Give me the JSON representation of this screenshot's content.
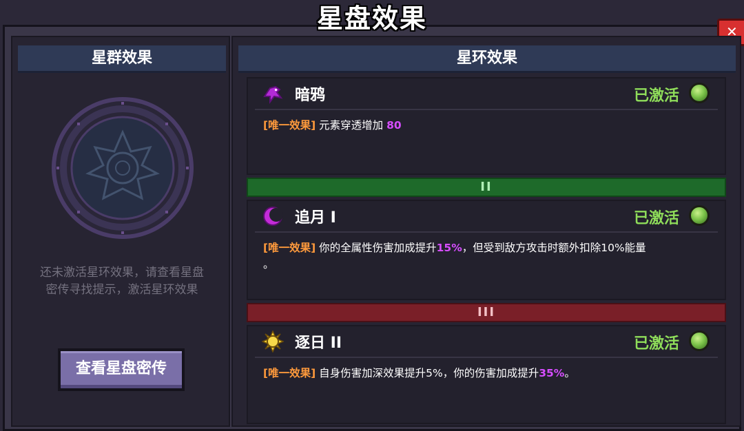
{
  "window": {
    "title": "星盘效果"
  },
  "left": {
    "title": "星群效果",
    "hint_line1": "还未激活星环效果，请查看星盘",
    "hint_line2": "密传寻找提示，激活星环效果",
    "button": "查看星盘密传"
  },
  "right": {
    "title": "星环效果",
    "effects": [
      {
        "name": "暗鸦",
        "icon": "raven-icon",
        "status": "已激活",
        "tag": "[唯一效果]",
        "desc_pre": "元素穿透增加",
        "highlight": "80",
        "desc_post": "",
        "desc_line2": ""
      },
      {
        "name": "追月 I",
        "icon": "crescent-moon-icon",
        "status": "已激活",
        "tag": "[唯一效果]",
        "desc_pre": "你的全属性伤害加成提升",
        "highlight": "15%",
        "desc_post": "，但受到敌方攻击时额外扣除10%能量",
        "desc_line2": "。"
      },
      {
        "name": "逐日 II",
        "icon": "sun-icon",
        "status": "已激活",
        "tag": "[唯一效果]",
        "desc_pre": "自身伤害加深效果提升5%，你的伤害加成提升",
        "highlight": "35%",
        "desc_post": "。",
        "desc_line2": ""
      }
    ],
    "tiers": [
      {
        "label": "II",
        "color": "#1e6a2a"
      },
      {
        "label": "III",
        "color": "#7a1f28"
      }
    ]
  },
  "colors": {
    "status_active": "#8fdd5a",
    "tag": "#ff9a3c",
    "highlight": "#d64dff"
  }
}
